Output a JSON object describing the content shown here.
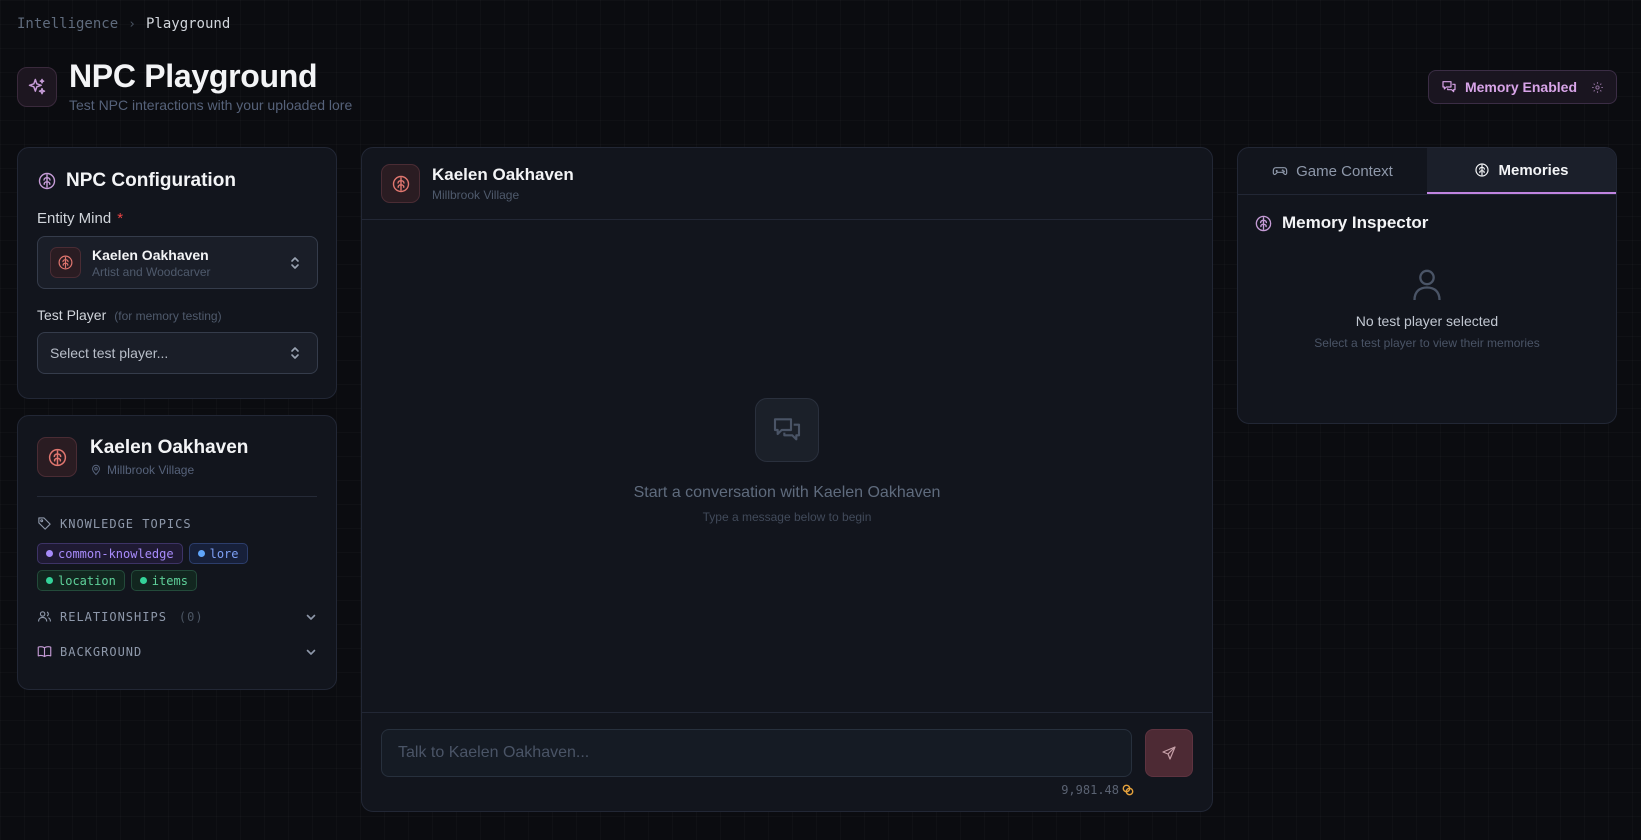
{
  "breadcrumb": {
    "parent": "Intelligence",
    "separator": "›",
    "current": "Playground"
  },
  "header": {
    "title": "NPC Playground",
    "subtitle": "Test NPC interactions with your uploaded lore",
    "memory_badge": "Memory Enabled",
    "accent_color": "#c084e0"
  },
  "config": {
    "title": "NPC Configuration",
    "entity_label": "Entity Mind",
    "required_mark": "*",
    "entity": {
      "name": "Kaelen Oakhaven",
      "role": "Artist and Woodcarver"
    },
    "player_label": "Test Player",
    "player_hint": "(for memory testing)",
    "player_placeholder": "Select test player..."
  },
  "npc": {
    "name": "Kaelen Oakhaven",
    "location": "Millbrook Village",
    "topics_label": "KNOWLEDGE TOPICS",
    "tags": [
      {
        "label": "common-knowledge",
        "color": "purple"
      },
      {
        "label": "lore",
        "color": "blue"
      },
      {
        "label": "location",
        "color": "green"
      },
      {
        "label": "items",
        "color": "green"
      }
    ],
    "relationships_label": "RELATIONSHIPS",
    "relationships_count": "(0)",
    "background_label": "BACKGROUND"
  },
  "chat": {
    "name": "Kaelen Oakhaven",
    "location": "Millbrook Village",
    "empty_title": "Start a conversation with Kaelen Oakhaven",
    "empty_sub": "Type a message below to begin",
    "input_placeholder": "Talk to Kaelen Oakhaven...",
    "credits": "9,981.48"
  },
  "right_panel": {
    "tabs": [
      {
        "label": "Game Context",
        "active": false
      },
      {
        "label": "Memories",
        "active": true
      }
    ],
    "inspector_title": "Memory Inspector",
    "empty_title": "No test player selected",
    "empty_sub": "Select a test player to view their memories"
  }
}
